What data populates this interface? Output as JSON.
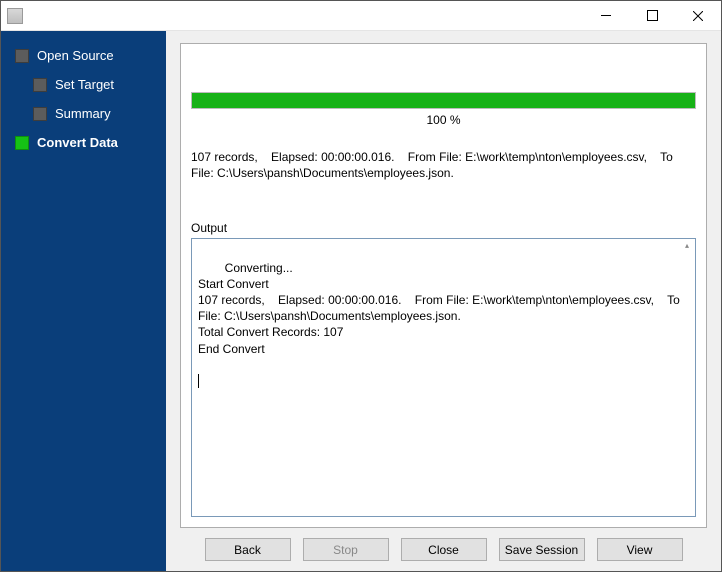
{
  "window": {
    "title": ""
  },
  "sidebar": {
    "items": [
      {
        "label": "Open Source",
        "active": false,
        "indent": false
      },
      {
        "label": "Set Target",
        "active": false,
        "indent": true
      },
      {
        "label": "Summary",
        "active": false,
        "indent": true
      },
      {
        "label": "Convert Data",
        "active": true,
        "indent": false
      }
    ]
  },
  "progress": {
    "percent": 100,
    "label": "100 %",
    "bar_color": "#17b217"
  },
  "summary": "107 records,    Elapsed: 00:00:00.016.    From File: E:\\work\\temp\\nton\\employees.csv,    To File: C:\\Users\\pansh\\Documents\\employees.json.",
  "output": {
    "label": "Output",
    "text": "Converting...\nStart Convert\n107 records,    Elapsed: 00:00:00.016.    From File: E:\\work\\temp\\nton\\employees.csv,    To File: C:\\Users\\pansh\\Documents\\employees.json.\nTotal Convert Records: 107\nEnd Convert"
  },
  "buttons": {
    "back": "Back",
    "stop": "Stop",
    "close": "Close",
    "save": "Save Session",
    "view": "View"
  }
}
